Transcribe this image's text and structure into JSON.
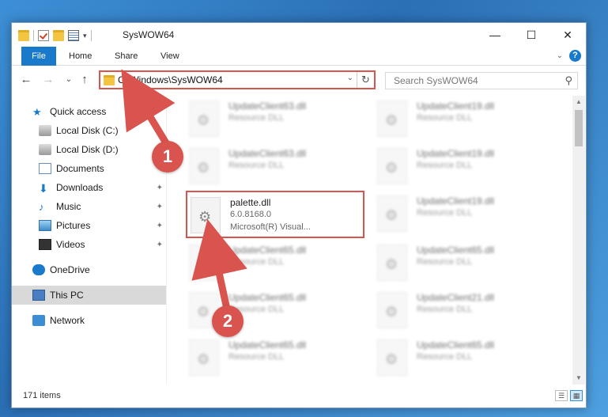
{
  "window": {
    "title": "SysWOW64",
    "minimize": "—",
    "maximize": "☐",
    "close": "✕"
  },
  "ribbon": {
    "tabs": [
      "File",
      "Home",
      "Share",
      "View"
    ],
    "expand": "⌄",
    "help": "?"
  },
  "nav": {
    "back": "←",
    "forward": "→",
    "recent": "⌄",
    "up": "↑",
    "address": "C:\\Windows\\SysWOW64",
    "address_caret": "⌄",
    "refresh": "↻",
    "search_placeholder": "Search SysWOW64",
    "search_icon": "⚲"
  },
  "sidebar": {
    "items": [
      {
        "label": "Quick access",
        "icon": "star-icon"
      },
      {
        "label": "Local Disk (C:)",
        "icon": "disk-icon",
        "pinned": true
      },
      {
        "label": "Local Disk (D:)",
        "icon": "disk-icon"
      },
      {
        "label": "Documents",
        "icon": "documents-icon",
        "pinned": true
      },
      {
        "label": "Downloads",
        "icon": "downloads-icon",
        "pinned": true
      },
      {
        "label": "Music",
        "icon": "music-icon",
        "pinned": true
      },
      {
        "label": "Pictures",
        "icon": "pictures-icon",
        "pinned": true
      },
      {
        "label": "Videos",
        "icon": "videos-icon",
        "pinned": true
      },
      {
        "label": "OneDrive",
        "icon": "onedrive-icon"
      },
      {
        "label": "This PC",
        "icon": "this-pc-icon",
        "selected": true
      },
      {
        "label": "Network",
        "icon": "network-icon"
      }
    ],
    "pin_glyph": "📌"
  },
  "files": {
    "left": [
      {
        "name": "UpdateClient63.dll",
        "sub1": "Resource DLL",
        "sub2": ""
      },
      {
        "name": "UpdateClient63.dll",
        "sub1": "Resource DLL",
        "sub2": ""
      },
      {
        "name": "palette.dll",
        "sub1": "6.0.8168.0",
        "sub2": "Microsoft(R) Visual..."
      },
      {
        "name": "UpdateClient65.dll",
        "sub1": "Resource DLL",
        "sub2": ""
      },
      {
        "name": "UpdateClient65.dll",
        "sub1": "Resource DLL",
        "sub2": ""
      },
      {
        "name": "UpdateClient65.dll",
        "sub1": "Resource DLL",
        "sub2": ""
      }
    ],
    "right": [
      {
        "name": "UpdateClient19.dll",
        "sub1": "Resource DLL",
        "sub2": ""
      },
      {
        "name": "UpdateClient19.dll",
        "sub1": "Resource DLL",
        "sub2": ""
      },
      {
        "name": "UpdateClient19.dll",
        "sub1": "Resource DLL",
        "sub2": ""
      },
      {
        "name": "UpdateClient65.dll",
        "sub1": "Resource DLL",
        "sub2": ""
      },
      {
        "name": "UpdateClient21.dll",
        "sub1": "Resource DLL",
        "sub2": ""
      },
      {
        "name": "UpdateClient65.dll",
        "sub1": "Resource DLL",
        "sub2": ""
      }
    ]
  },
  "status": {
    "count": "171 items",
    "details_view": "☰",
    "tiles_view": "▦"
  },
  "annotations": {
    "step1": "1",
    "step2": "2",
    "color": "#d9534f"
  }
}
